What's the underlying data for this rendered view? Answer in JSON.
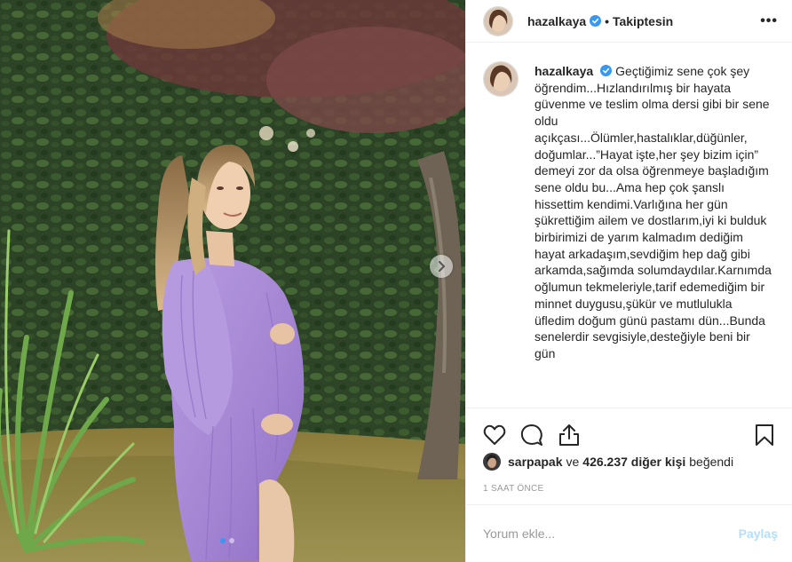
{
  "post": {
    "username": "hazalkaya",
    "follow_status": "• Takiptesin",
    "more_label": "•••",
    "caption": "Geçtiğimiz sene çok şey öğrendim...Hızlandırılmış bir hayata güvenme ve teslim olma dersi gibi bir sene oldu açıkçası...Ölümler,hastalıklar,düğünler, doğumlar...”Hayat işte,her şey bizim için” demeyi zor da olsa öğrenmeye başladığım sene oldu bu...Ama hep çok şanslı hissettim kendimi.Varlığına her gün şükrettiğim ailem ve dostlarım,iyi ki bulduk birbirimizi de yarım kalmadım dediğim hayat arkadaşım,sevdiğim hep dağ gibi arkamda,sağımda solumdaydılar.Karnımda oğlumun tekmeleriyle,tarif edemediğim bir minnet duygusu,şükür ve mutlulukla üfledim doğum günü pastamı dün...Bunda senelerdir sevgisiyle,desteğiyle beni bir gün",
    "liked_by_user": "sarpapak",
    "likes_middle": "ve",
    "likes_count": "426.237 diğer kişi",
    "likes_suffix": "beğendi",
    "timestamp": "1 SAAT ÖNCE",
    "photo_slide_index": 1,
    "photo_slide_total": 2
  },
  "comment_box": {
    "placeholder": "Yorum ekle...",
    "post_label": "Paylaş"
  },
  "icons": {
    "verified": "verified-badge-icon",
    "like": "heart-icon",
    "comment": "comment-bubble-icon",
    "share": "share-upload-icon",
    "save": "bookmark-icon",
    "next": "chevron-right-icon"
  },
  "colors": {
    "verified_blue": "#3897f0",
    "post_button_disabled": "#b2dffc",
    "dress_purple": "#a98ad6",
    "muted_text": "#999999"
  }
}
